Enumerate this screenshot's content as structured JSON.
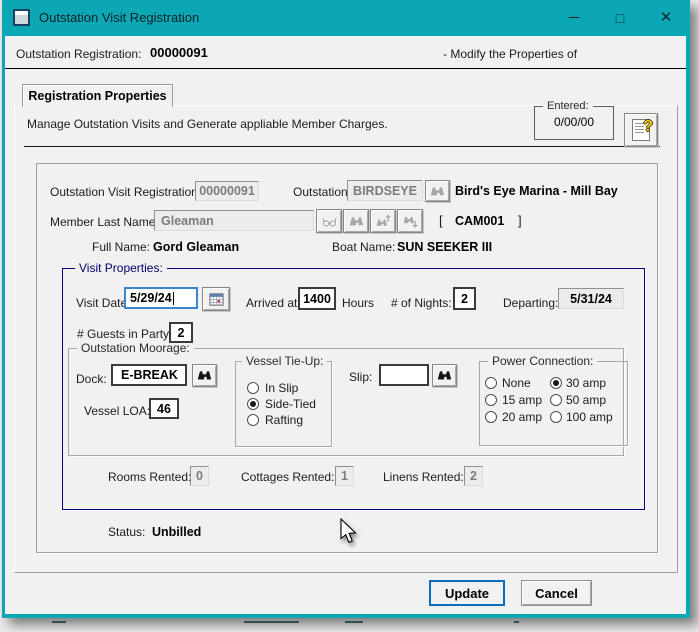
{
  "window": {
    "title": "Outstation Visit Registration",
    "controls": {
      "minimize": "─",
      "maximize": "□",
      "close": "✕"
    }
  },
  "header": {
    "label": "Outstation Registration:",
    "value": "00000091",
    "right_text": "- Modify the Properties of"
  },
  "tab": {
    "label": "Registration Properties"
  },
  "intro": {
    "text": "Manage Outstation Visits and Generate appliable Member Charges.",
    "entered_label": "Entered:",
    "entered_value": "0/00/00"
  },
  "identity": {
    "reg_id_label": "Outstation Visit Registration ID:",
    "reg_id_value": "00000091",
    "outstation_label": "Outstation:",
    "outstation_value": "BIRDSEYE",
    "outstation_name": "Bird's Eye Marina - Mill Bay",
    "member_label": "Member Last Name:",
    "member_value": "Gleaman",
    "member_code_open": "[",
    "member_code": "CAM001",
    "member_code_close": "]",
    "full_name_label": "Full Name:",
    "full_name": "Gord Gleaman",
    "boat_label": "Boat Name:",
    "boat_name": "SUN SEEKER III"
  },
  "visit": {
    "group_label": "Visit Properties:",
    "visit_date_label": "Visit Date:",
    "visit_date": "5/29/24",
    "arrived_label": "Arrived at:",
    "arrived": "1400",
    "hours_label": "Hours",
    "nights_label": "# of Nights:",
    "nights": "2",
    "departing_label": "Departing:",
    "departing": "5/31/24",
    "guests_label": "# Guests in Party:",
    "guests": "2",
    "moorage": {
      "group_label": "Outstation Moorage:",
      "dock_label": "Dock:",
      "dock": "E-BREAK",
      "loa_label": "Vessel LOA:",
      "loa": "46",
      "tieup_label": "Vessel Tie-Up:",
      "tieup_options": [
        "In Slip",
        "Side-Tied",
        "Rafting"
      ],
      "tieup_selected": "Side-Tied",
      "slip_label": "Slip:",
      "slip": "",
      "power_label": "Power Connection:",
      "power_options": [
        "None",
        "15 amp",
        "20 amp",
        "30 amp",
        "50 amp",
        "100 amp"
      ],
      "power_selected": "30 amp"
    },
    "rooms_label": "Rooms Rented:",
    "rooms": "0",
    "cottages_label": "Cottages Rented:",
    "cottages": "1",
    "linens_label": "Linens Rented:",
    "linens": "2"
  },
  "status": {
    "label": "Status:",
    "value": "Unbilled"
  },
  "buttons": {
    "update": "Update",
    "cancel": "Cancel"
  },
  "colors": {
    "titlebar": "#0ba7b4",
    "focus_border": "#3a86cf",
    "primary_button_border": "#0a6cc0",
    "group_border_navy": "#000080"
  }
}
